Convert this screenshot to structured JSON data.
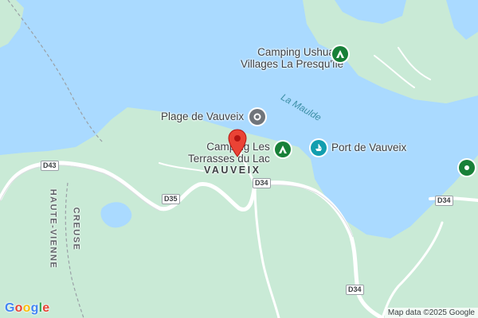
{
  "map": {
    "water_color": "#aadaff",
    "land_color": "#c9ead6",
    "road_color": "#ffffff",
    "accent_poi": "#188038",
    "accent_marina": "#129eaf",
    "accent_beach": "#70757a",
    "pin_color": "#ea4335"
  },
  "places": {
    "camping_ushuaia_line1": "Camping Ushuaïa",
    "camping_ushuaia_line2": "Villages La Presqu'île",
    "plage": "Plage de Vauveix",
    "camping_terrasses_line1": "Camping Les",
    "camping_terrasses_line2": "Terrasses du Lac",
    "port": "Port de Vauveix",
    "village": "VAUVEIX"
  },
  "water": {
    "lake_name": "La Maulde"
  },
  "regions": {
    "haute_vienne": "HAUTE-VIENNE",
    "creuse": "CREUSE"
  },
  "roads": {
    "d43": "D43",
    "d35": "D35",
    "d34_a": "D34",
    "d34_b": "D34",
    "d34_c": "D34"
  },
  "footer": {
    "logo_letters": [
      "G",
      "o",
      "o",
      "g",
      "l",
      "e"
    ],
    "logo_colors": [
      "#4285f4",
      "#ea4335",
      "#fbbc05",
      "#4285f4",
      "#34a853",
      "#ea4335"
    ],
    "attribution": "Map data ©2025 Google"
  },
  "icons": {
    "camping": "tent-icon",
    "beach": "beach-icon",
    "marina": "boat-icon",
    "pin": "location-pin-icon"
  }
}
